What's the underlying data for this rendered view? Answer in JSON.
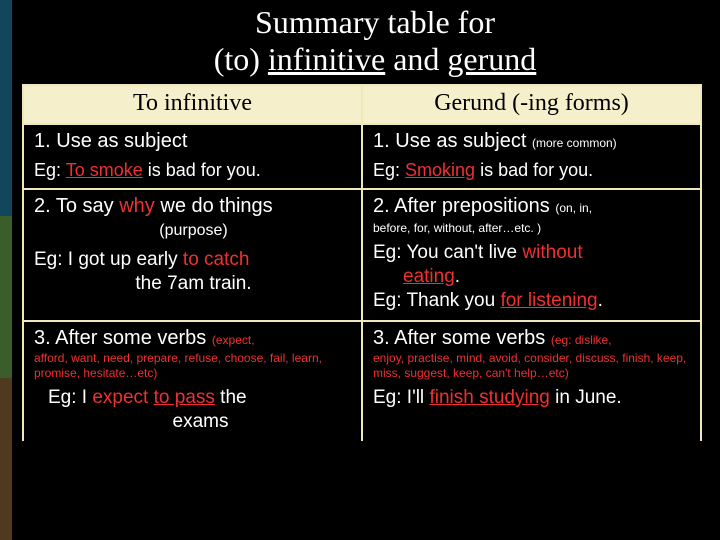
{
  "title": {
    "line1": "Summary table for",
    "line2_pre": "(to) ",
    "line2_u1": "infinitive",
    "line2_mid": " and ",
    "line2_u2": "gerund"
  },
  "headers": {
    "left": "To infinitive",
    "right": "Gerund (-ing forms)"
  },
  "row1": {
    "left_num": "1.  ",
    "left_text": "Use as subject",
    "left_eg_pre": "Eg: ",
    "left_eg_red": "To smoke",
    "left_eg_post": " is bad for you.",
    "right_num": "1.  ",
    "right_text": "Use as subject ",
    "right_small": "(more common)",
    "right_eg_pre": "Eg: ",
    "right_eg_red": "Smoking",
    "right_eg_post": " is bad for you."
  },
  "row2": {
    "left_num": "2.  ",
    "left_pre": "To say ",
    "left_red1": "why",
    "left_post": " we do things",
    "left_small": "(purpose)",
    "left_eg_pre": "Eg: I got up early ",
    "left_eg_red": "to catch",
    "left_eg_post2": "the 7am train.",
    "right_num": "2.  ",
    "right_text": "After prepositions ",
    "right_small": "(on, in,",
    "right_small_line2": "before, for, without, after…etc. )",
    "right_eg1_pre": "Eg: You can't live ",
    "right_eg1_red": "without",
    "right_eg1_red2": "eating",
    "right_eg1_post": ".",
    "right_eg2_pre": "Eg: Thank you ",
    "right_eg2_red": "for listening",
    "right_eg2_post": "."
  },
  "row3": {
    "left_num": "3. ",
    "left_text": "After some verbs ",
    "left_small": "(expect,",
    "left_note": "afford, want, need, prepare, refuse, choose, fail, learn, promise, hesitate…etc)",
    "left_eg_pre": "Eg: I ",
    "left_eg_red1": "expect",
    "left_eg_mid": " ",
    "left_eg_red2": "to pass",
    "left_eg_post": " the",
    "left_eg_line2": "exams",
    "right_num": "3. ",
    "right_text": "After some verbs ",
    "right_small": "(eg: dislike,",
    "right_note": "enjoy, practise, mind, avoid, consider, discuss, finish, keep, miss, suggest, keep, can't help…etc)",
    "right_eg_pre": "Eg: I'll ",
    "right_eg_red": "finish studying",
    "right_eg_post": " in June."
  }
}
